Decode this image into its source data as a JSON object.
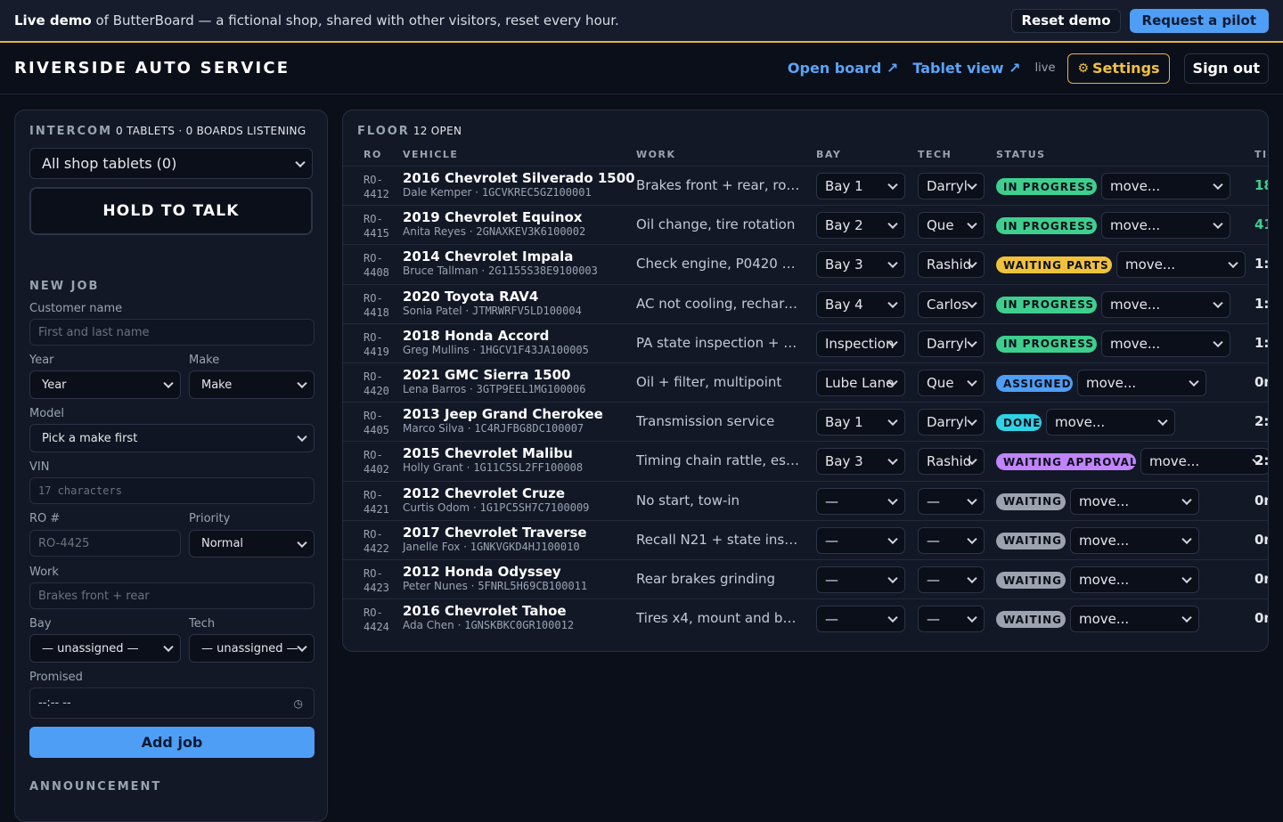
{
  "banner": {
    "lead": "Live demo",
    "text": " of ButterBoard — a fictional shop, shared with other visitors, reset every hour.",
    "reset_label": "Reset demo",
    "pilot_label": "Request a pilot"
  },
  "header": {
    "brand": "RIVERSIDE AUTO SERVICE",
    "open_board": "Open board ↗",
    "tablet_view": "Tablet view ↗",
    "live": "live",
    "settings": "Settings",
    "sign_out": "Sign out"
  },
  "intercom": {
    "title": "INTERCOM",
    "status": "0 TABLETS · 0 BOARDS LISTENING",
    "target": "All shop tablets (0)",
    "talk": "HOLD TO TALK"
  },
  "new_job": {
    "title": "NEW JOB",
    "customer_label": "Customer name",
    "customer_placeholder": "First and last name",
    "year_label": "Year",
    "year_value": "Year",
    "make_label": "Make",
    "make_value": "Make",
    "model_label": "Model",
    "model_value": "Pick a make first",
    "vin_label": "VIN",
    "vin_placeholder": "17 characters",
    "ro_label": "RO #",
    "ro_placeholder": "RO-4425",
    "priority_label": "Priority",
    "priority_value": "Normal",
    "work_label": "Work",
    "work_placeholder": "Brakes front + rear",
    "bay_label": "Bay",
    "bay_value": "— unassigned —",
    "tech_label": "Tech",
    "tech_value": "— unassigned —",
    "promised_label": "Promised",
    "promised_value": "--:-- --",
    "add_label": "Add job"
  },
  "announcement": {
    "title": "ANNOUNCEMENT"
  },
  "floor": {
    "title": "FLOOR",
    "open_count": "12 OPEN",
    "columns": {
      "ro": "RO",
      "vehicle": "VEHICLE",
      "work": "WORK",
      "bay": "BAY",
      "tech": "TECH",
      "status": "STATUS",
      "time": "TI"
    },
    "rows": [
      {
        "ro1": "RO-",
        "ro2": "4412",
        "vehicle": "2016 Chevrolet Silverado 1500",
        "customer": "Dale Kemper",
        "vin": "1GCVKREC5GZ100001",
        "work": "Brakes front + rear, rot...",
        "bay": "Bay 1",
        "tech": "Darryl",
        "status": "IN PROGRESS",
        "move": "move...",
        "time": "18"
      },
      {
        "ro1": "RO-",
        "ro2": "4415",
        "vehicle": "2019 Chevrolet Equinox",
        "customer": "Anita Reyes",
        "vin": "2GNAXKEV3K6100002",
        "work": "Oil change, tire rotation",
        "bay": "Bay 2",
        "tech": "Que",
        "status": "IN PROGRESS",
        "move": "move...",
        "time": "41"
      },
      {
        "ro1": "RO-",
        "ro2": "4408",
        "vehicle": "2014 Chevrolet Impala",
        "customer": "Bruce Tallman",
        "vin": "2G1155S38E9100003",
        "work": "Check engine, P0420 di...",
        "bay": "Bay 3",
        "tech": "Rashid",
        "status": "WAITING PARTS",
        "move": "move...",
        "time": "1:"
      },
      {
        "ro1": "RO-",
        "ro2": "4418",
        "vehicle": "2020 Toyota RAV4",
        "customer": "Sonia Patel",
        "vin": "JTMRWRFV5LD100004",
        "work": "AC not cooling, recharg...",
        "bay": "Bay 4",
        "tech": "Carlos",
        "status": "IN PROGRESS",
        "move": "move...",
        "time": "1:"
      },
      {
        "ro1": "RO-",
        "ro2": "4419",
        "vehicle": "2018 Honda Accord",
        "customer": "Greg Mullins",
        "vin": "1HGCV1F43JA100005",
        "work": "PA state inspection + e...",
        "bay": "Inspection",
        "tech": "Darryl",
        "status": "IN PROGRESS",
        "move": "move...",
        "time": "1:"
      },
      {
        "ro1": "RO-",
        "ro2": "4420",
        "vehicle": "2021 GMC Sierra 1500",
        "customer": "Lena Barros",
        "vin": "3GTP9EEL1MG100006",
        "work": "Oil + filter, multipoint",
        "bay": "Lube Lane",
        "tech": "Que",
        "status": "ASSIGNED",
        "move": "move...",
        "time": "0m"
      },
      {
        "ro1": "RO-",
        "ro2": "4405",
        "vehicle": "2013 Jeep Grand Cherokee",
        "customer": "Marco Silva",
        "vin": "1C4RJFBG8DC100007",
        "work": "Transmission service",
        "bay": "Bay 1",
        "tech": "Darryl",
        "status": "DONE",
        "move": "move...",
        "time": "2:"
      },
      {
        "ro1": "RO-",
        "ro2": "4402",
        "vehicle": "2015 Chevrolet Malibu",
        "customer": "Holly Grant",
        "vin": "1G11C5SL2FF100008",
        "work": "Timing chain rattle, esti...",
        "bay": "Bay 3",
        "tech": "Rashid",
        "status": "WAITING APPROVAL",
        "move": "move...",
        "time": "2:"
      },
      {
        "ro1": "RO-",
        "ro2": "4421",
        "vehicle": "2012 Chevrolet Cruze",
        "customer": "Curtis Odom",
        "vin": "1G1PC5SH7C7100009",
        "work": "No start, tow-in",
        "bay": "—",
        "tech": "—",
        "status": "WAITING",
        "move": "move...",
        "time": "0m"
      },
      {
        "ro1": "RO-",
        "ro2": "4422",
        "vehicle": "2017 Chevrolet Traverse",
        "customer": "Janelle Fox",
        "vin": "1GNKVGKD4HJ100010",
        "work": "Recall N21 + state insp...",
        "bay": "—",
        "tech": "—",
        "status": "WAITING",
        "move": "move...",
        "time": "0m"
      },
      {
        "ro1": "RO-",
        "ro2": "4423",
        "vehicle": "2012 Honda Odyssey",
        "customer": "Peter Nunes",
        "vin": "5FNRL5H69CB100011",
        "work": "Rear brakes grinding",
        "bay": "—",
        "tech": "—",
        "status": "WAITING",
        "move": "move...",
        "time": "0m"
      },
      {
        "ro1": "RO-",
        "ro2": "4424",
        "vehicle": "2016 Chevrolet Tahoe",
        "customer": "Ada Chen",
        "vin": "1GNSKBKC0GR100012",
        "work": "Tires x4, mount and bal...",
        "bay": "—",
        "tech": "—",
        "status": "WAITING",
        "move": "move...",
        "time": "0m"
      }
    ]
  },
  "status_colors": {
    "IN PROGRESS": "#3ecf8e",
    "WAITING PARTS": "#f0c23b",
    "ASSIGNED": "#4f9ef5",
    "DONE": "#2ed3e6",
    "WAITING APPROVAL": "#c084fc",
    "WAITING": "#9ca3af"
  },
  "time_color_green": "#3ecf8e"
}
